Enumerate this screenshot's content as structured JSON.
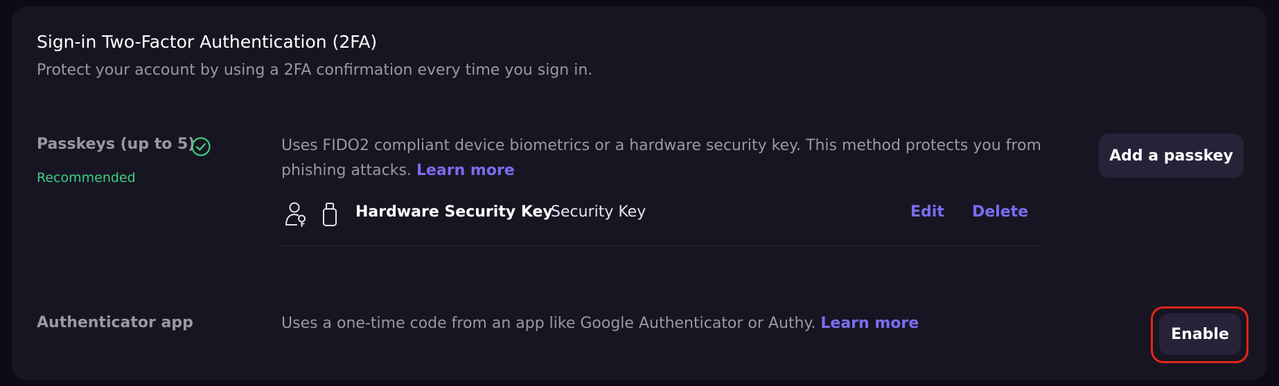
{
  "section": {
    "title": "Sign-in Two-Factor Authentication (2FA)",
    "subtitle": "Protect your account by using a 2FA confirmation every time you sign in."
  },
  "passkeys": {
    "label": "Passkeys (up to 5)",
    "badge": "Recommended",
    "description": "Uses FIDO2 compliant device biometrics or a hardware security key. This method protects you from phishing attacks.",
    "learn_more": "Learn more",
    "add_button": "Add a passkey",
    "icons": [
      "check-circle-icon",
      "user-key-icon",
      "usb-key-icon"
    ],
    "items": [
      {
        "name": "Hardware Security Key",
        "type": "Security Key",
        "edit": "Edit",
        "delete": "Delete"
      }
    ]
  },
  "authenticator": {
    "label": "Authenticator app",
    "description": "Uses a one-time code from an app like Google Authenticator or Authy.",
    "learn_more": "Learn more",
    "enable_button": "Enable"
  },
  "colors": {
    "background": "#0e0b17",
    "card": "#181522",
    "accent": "#7b6cf0",
    "success": "#3ecf83",
    "highlight": "#e2261a",
    "button": "#272238"
  }
}
